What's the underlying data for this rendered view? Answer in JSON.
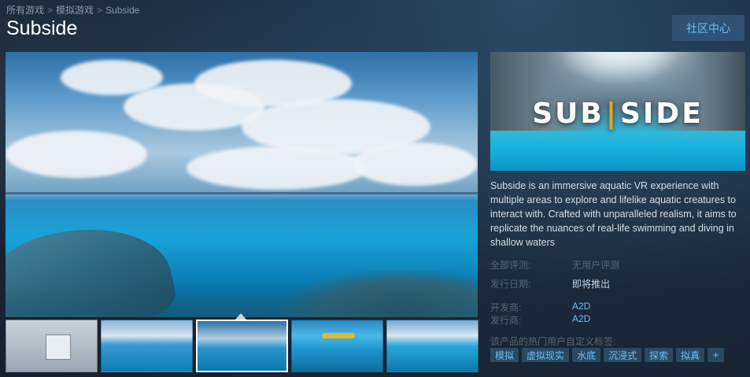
{
  "breadcrumb": [
    "所有游戏",
    "模拟游戏",
    "Subside"
  ],
  "breadcrumb_separator": ">",
  "title": "Subside",
  "community_hub_label": "社区中心",
  "capsule": {
    "logo_left": "SUB",
    "logo_bar": "|",
    "logo_right": "SIDE"
  },
  "description": "Subside is an immersive aquatic VR experience with multiple areas to explore and lifelike aquatic creatures to interact with. Crafted with unparalleled realism, it aims to replicate the nuances of real-life swimming and diving in shallow waters",
  "info": {
    "review_label": "全部评测:",
    "review_value": "无用户评测",
    "release_label": "发行日期:",
    "release_value": "即将推出",
    "developer_label": "开发商:",
    "developer_value": "A2D",
    "publisher_label": "发行商:",
    "publisher_value": "A2D"
  },
  "tags_label": "该产品的热门用户自定义标签:",
  "tags": [
    "模拟",
    "虚拟现实",
    "水底",
    "沉浸式",
    "探索",
    "拟真",
    "+"
  ],
  "thumbnails": {
    "count": 5,
    "selected_index": 2
  },
  "colors": {
    "background": "#1b2838",
    "link": "#66c0f4",
    "tag_bg": "#2b4a62",
    "button_bg": "#2f5173",
    "logo_accent": "#e3a81c"
  }
}
